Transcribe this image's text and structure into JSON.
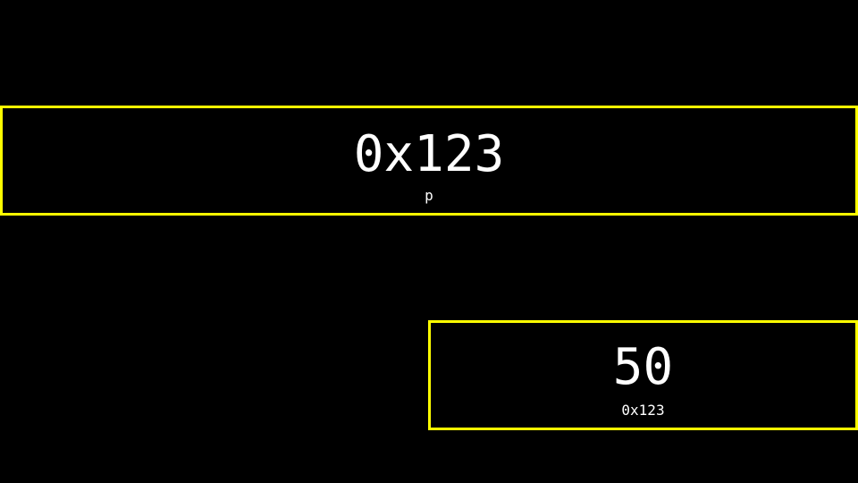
{
  "colors": {
    "background": "#000000",
    "border": "#ffff00",
    "text": "#ffffff"
  },
  "pointer_box": {
    "value": "0x123",
    "label": "p"
  },
  "target_box": {
    "value": "50",
    "label": "0x123"
  }
}
